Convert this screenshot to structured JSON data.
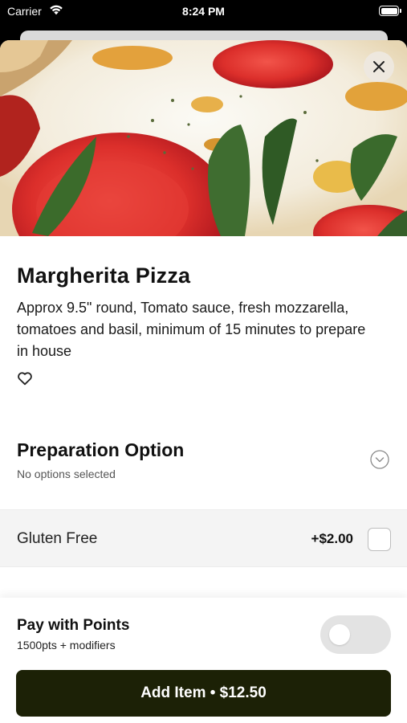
{
  "status_bar": {
    "carrier": "Carrier",
    "time": "8:24 PM",
    "wifi_icon": "wifi-icon",
    "battery_icon": "battery-icon"
  },
  "item": {
    "image_alt": "Margherita pizza close-up",
    "name": "Margherita Pizza",
    "description": "Approx 9.5\" round, Tomato sauce, fresh mozzarella, tomatoes and basil, minimum of 15 minutes to prepare in house",
    "favorite_icon": "heart-outline-icon",
    "close_icon": "close-icon"
  },
  "preparation": {
    "title": "Preparation Option",
    "subtitle": "No options selected",
    "chevron_icon": "chevron-down-circle-icon",
    "options": [
      {
        "label": "Gluten Free",
        "price": "+$2.00",
        "checked": false
      }
    ]
  },
  "footer": {
    "pay_title": "Pay with Points",
    "pay_subtitle": "1500pts + modifiers",
    "pay_toggle_on": false,
    "add_button_label": "Add Item • $12.50"
  },
  "colors": {
    "primary_button": "#1c2106",
    "toggle_off": "#e3e3e3",
    "option_bg": "#f4f4f4"
  }
}
